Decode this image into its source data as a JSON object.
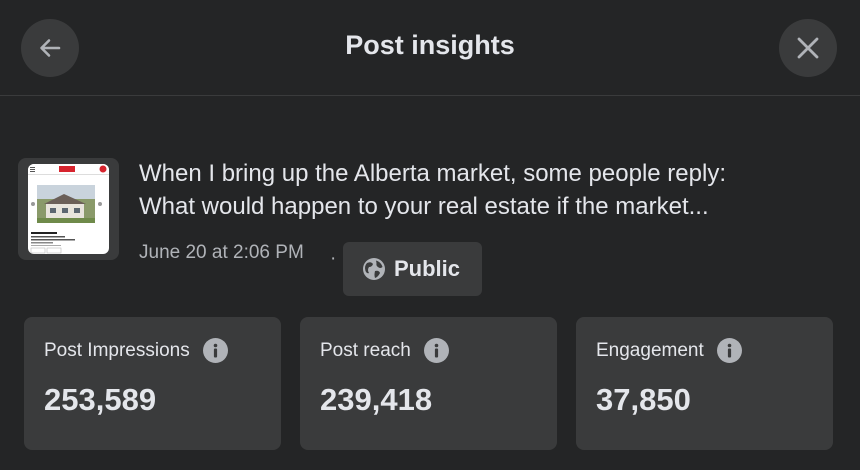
{
  "header": {
    "title": "Post insights"
  },
  "post": {
    "line1": "When I bring up the Alberta market, some people reply:",
    "line2": "What would happen to your real estate if the market...",
    "timestamp": "June 20 at 2:06 PM",
    "separator": "·",
    "audience_label": "Public",
    "thumbnail": {
      "price": "$9,800,000",
      "location": "Vancouver, British Columbia V6S1T8"
    }
  },
  "metrics": [
    {
      "label": "Post Impressions",
      "value": "253,589"
    },
    {
      "label": "Post reach",
      "value": "239,418"
    },
    {
      "label": "Engagement",
      "value": "37,850"
    }
  ],
  "colors": {
    "background": "#242526",
    "surface": "#3a3b3c",
    "text": "#e4e6eb",
    "secondary_text": "#b0b3b8"
  }
}
